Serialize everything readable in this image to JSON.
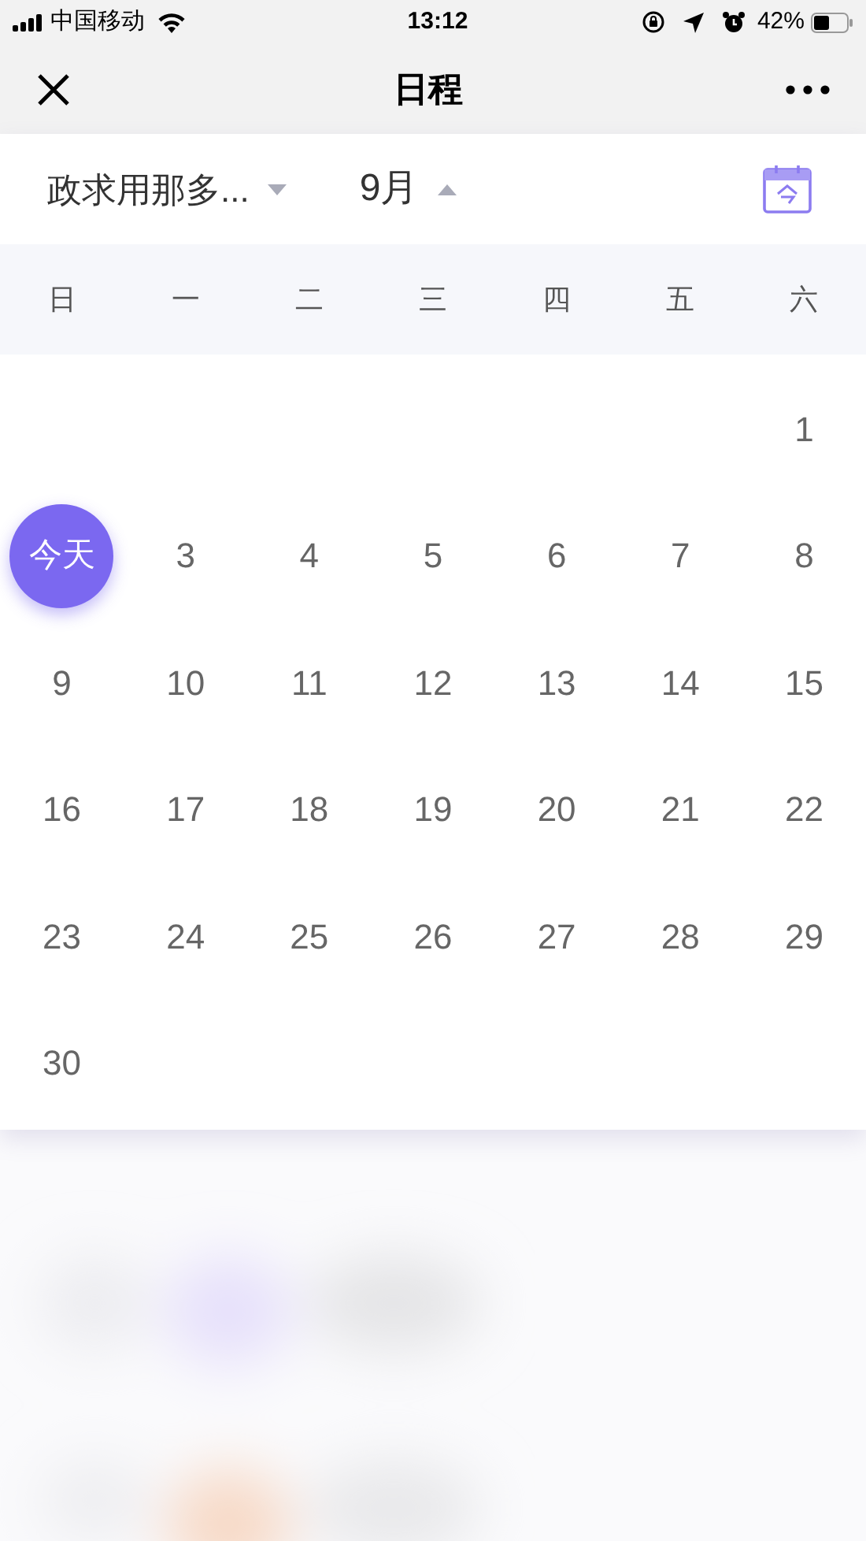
{
  "status_bar": {
    "carrier": "中国移动",
    "time": "13:12",
    "battery": "42%"
  },
  "nav": {
    "title": "日程"
  },
  "filters": {
    "calendar": "政求用那多...",
    "month": "9月"
  },
  "weekdays": [
    "日",
    "一",
    "二",
    "三",
    "四",
    "五",
    "六"
  ],
  "days": [
    {
      "kind": "blank"
    },
    {
      "kind": "blank"
    },
    {
      "kind": "blank"
    },
    {
      "kind": "blank"
    },
    {
      "kind": "blank"
    },
    {
      "kind": "blank"
    },
    {
      "kind": "day",
      "label": "1",
      "today": false
    },
    {
      "kind": "day",
      "label": "今天",
      "today": true
    },
    {
      "kind": "day",
      "label": "3",
      "today": false
    },
    {
      "kind": "day",
      "label": "4",
      "today": false
    },
    {
      "kind": "day",
      "label": "5",
      "today": false
    },
    {
      "kind": "day",
      "label": "6",
      "today": false
    },
    {
      "kind": "day",
      "label": "7",
      "today": false
    },
    {
      "kind": "day",
      "label": "8",
      "today": false
    },
    {
      "kind": "day",
      "label": "9",
      "today": false
    },
    {
      "kind": "day",
      "label": "10",
      "today": false
    },
    {
      "kind": "day",
      "label": "11",
      "today": false
    },
    {
      "kind": "day",
      "label": "12",
      "today": false
    },
    {
      "kind": "day",
      "label": "13",
      "today": false
    },
    {
      "kind": "day",
      "label": "14",
      "today": false
    },
    {
      "kind": "day",
      "label": "15",
      "today": false
    },
    {
      "kind": "day",
      "label": "16",
      "today": false
    },
    {
      "kind": "day",
      "label": "17",
      "today": false
    },
    {
      "kind": "day",
      "label": "18",
      "today": false
    },
    {
      "kind": "day",
      "label": "19",
      "today": false
    },
    {
      "kind": "day",
      "label": "20",
      "today": false
    },
    {
      "kind": "day",
      "label": "21",
      "today": false
    },
    {
      "kind": "day",
      "label": "22",
      "today": false
    },
    {
      "kind": "day",
      "label": "23",
      "today": false
    },
    {
      "kind": "day",
      "label": "24",
      "today": false
    },
    {
      "kind": "day",
      "label": "25",
      "today": false
    },
    {
      "kind": "day",
      "label": "26",
      "today": false
    },
    {
      "kind": "day",
      "label": "27",
      "today": false
    },
    {
      "kind": "day",
      "label": "28",
      "today": false
    },
    {
      "kind": "day",
      "label": "29",
      "today": false
    },
    {
      "kind": "day",
      "label": "30",
      "today": false
    }
  ]
}
